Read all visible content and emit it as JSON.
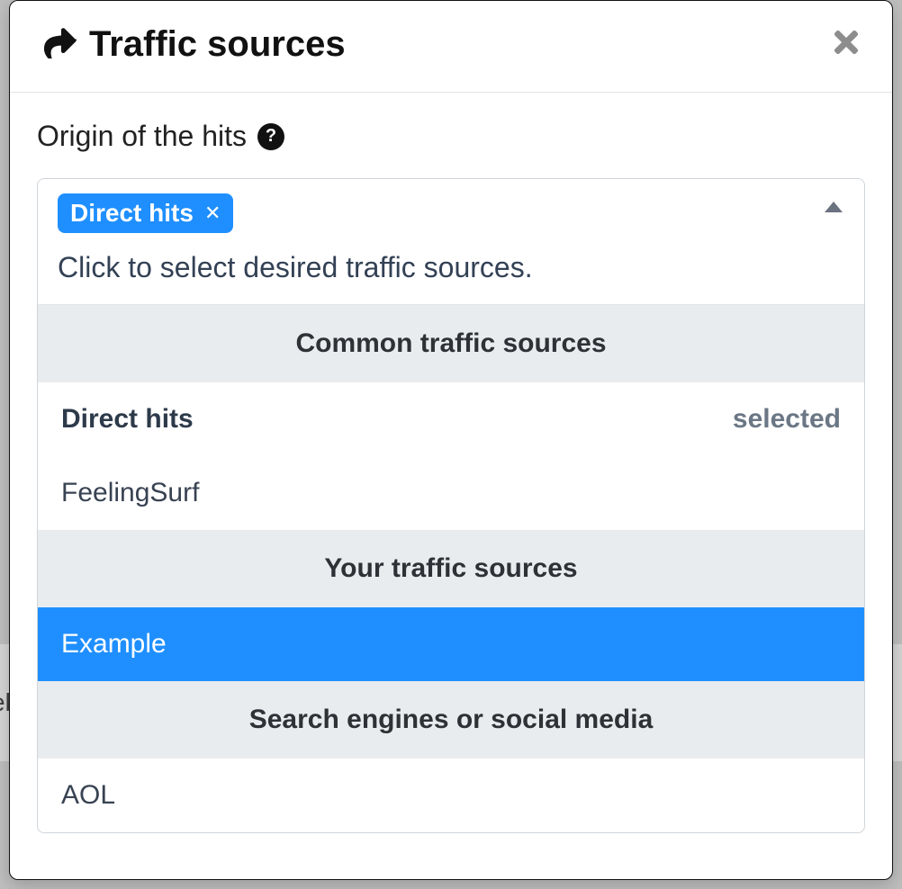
{
  "background": {
    "partial_text": "eb"
  },
  "modal": {
    "title": "Traffic sources",
    "field_label": "Origin of the hits",
    "selected_tags": [
      {
        "label": "Direct hits"
      }
    ],
    "input_placeholder": "Click to select desired traffic sources.",
    "groups": [
      {
        "header": "Common traffic sources",
        "options": [
          {
            "label": "Direct hits",
            "selected": true,
            "selected_text": "selected"
          },
          {
            "label": "FeelingSurf",
            "selected": false
          }
        ]
      },
      {
        "header": "Your traffic sources",
        "options": [
          {
            "label": "Example",
            "selected": false,
            "highlight": true
          }
        ]
      },
      {
        "header": "Search engines or social media",
        "options": [
          {
            "label": "AOL",
            "selected": false
          }
        ]
      }
    ]
  }
}
